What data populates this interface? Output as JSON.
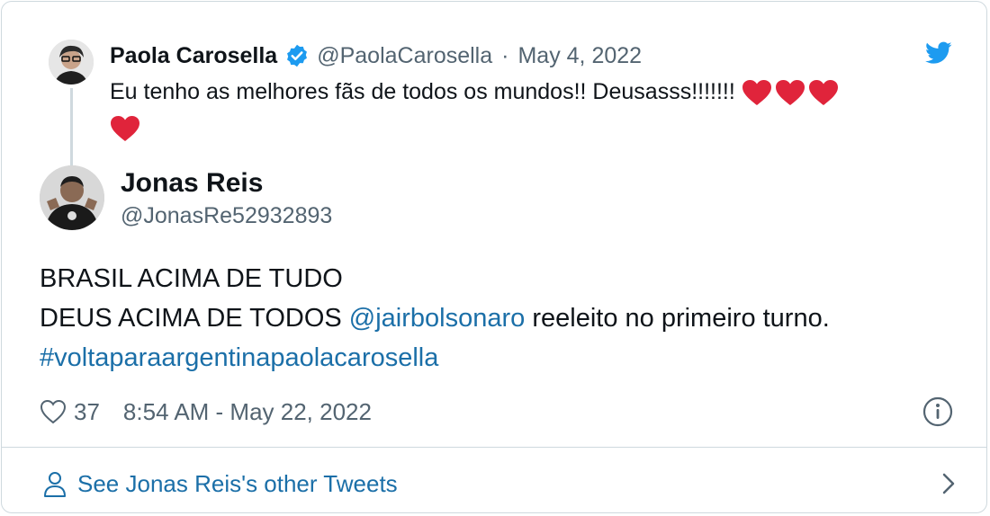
{
  "parent_tweet": {
    "author_name": "Paola Carosella",
    "handle": "@PaolaCarosella",
    "separator": "·",
    "date": "May 4, 2022",
    "text": "Eu tenho as melhores fãs de todos os mundos!! Deusasss!!!!!!!",
    "emojis": [
      "red-heart",
      "red-heart",
      "red-heart",
      "red-heart"
    ],
    "verified": true
  },
  "reply_tweet": {
    "author_name": "Jonas Reis",
    "handle": "@JonasRe52932893",
    "line1": "BRASIL ACIMA DE TUDO",
    "line2_prefix": "DEUS ACIMA DE TODOS ",
    "mention": "@jairbolsonaro",
    "line2_suffix": " reeleito no primeiro turno.",
    "hashtag": "#voltaparaargentinapaolacarosella",
    "like_count": "37",
    "timestamp": "8:54 AM - May 22, 2022"
  },
  "footer": {
    "label": "See Jonas Reis's other Tweets"
  },
  "icons": {
    "brand": "twitter-bird-icon",
    "verified": "verified-badge-icon",
    "like": "heart-outline-icon",
    "info": "info-icon",
    "person": "person-icon",
    "chevron": "chevron-right-icon"
  },
  "colors": {
    "twitter_blue": "#1d9bf0",
    "link": "#1b6fa8",
    "muted": "#536471",
    "heart_red": "#e0243b",
    "border": "#cfd9de"
  }
}
